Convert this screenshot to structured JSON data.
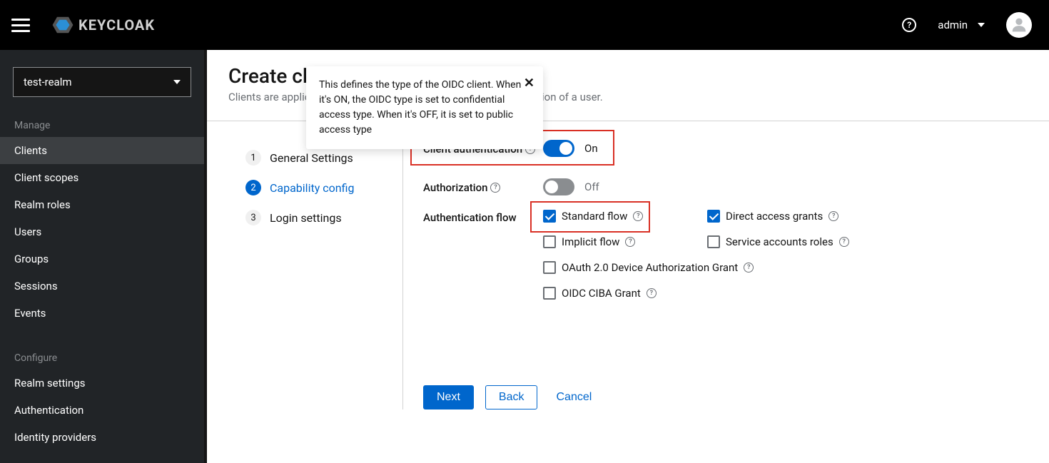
{
  "brand": "KEYCLOAK",
  "header": {
    "username": "admin"
  },
  "sidebar": {
    "realm": "test-realm",
    "sections": [
      {
        "label": "Manage",
        "items": [
          "Clients",
          "Client scopes",
          "Realm roles",
          "Users",
          "Groups",
          "Sessions",
          "Events"
        ],
        "activeIndex": 0
      },
      {
        "label": "Configure",
        "items": [
          "Realm settings",
          "Authentication",
          "Identity providers"
        ],
        "activeIndex": -1
      }
    ]
  },
  "page": {
    "title": "Create client",
    "subtitle_before": "Clients are applic",
    "subtitle_after": "ation of a user."
  },
  "tooltip": {
    "text": "This defines the type of the OIDC client. When it's ON, the OIDC type is set to confidential access type. When it's OFF, it is set to public access type"
  },
  "wizard": {
    "steps": [
      "General Settings",
      "Capability config",
      "Login settings"
    ],
    "currentIndex": 1
  },
  "form": {
    "client_auth": {
      "label": "Client authentication",
      "value": "On",
      "on": true
    },
    "authorization": {
      "label": "Authorization",
      "value": "Off",
      "on": false
    },
    "auth_flow_label": "Authentication flow",
    "flows": {
      "standard": {
        "label": "Standard flow",
        "checked": true
      },
      "direct": {
        "label": "Direct access grants",
        "checked": true
      },
      "implicit": {
        "label": "Implicit flow",
        "checked": false
      },
      "service": {
        "label": "Service accounts roles",
        "checked": false
      },
      "oauth_device": {
        "label": "OAuth 2.0 Device Authorization Grant",
        "checked": false
      },
      "ciba": {
        "label": "OIDC CIBA Grant",
        "checked": false
      }
    }
  },
  "buttons": {
    "next": "Next",
    "back": "Back",
    "cancel": "Cancel"
  }
}
